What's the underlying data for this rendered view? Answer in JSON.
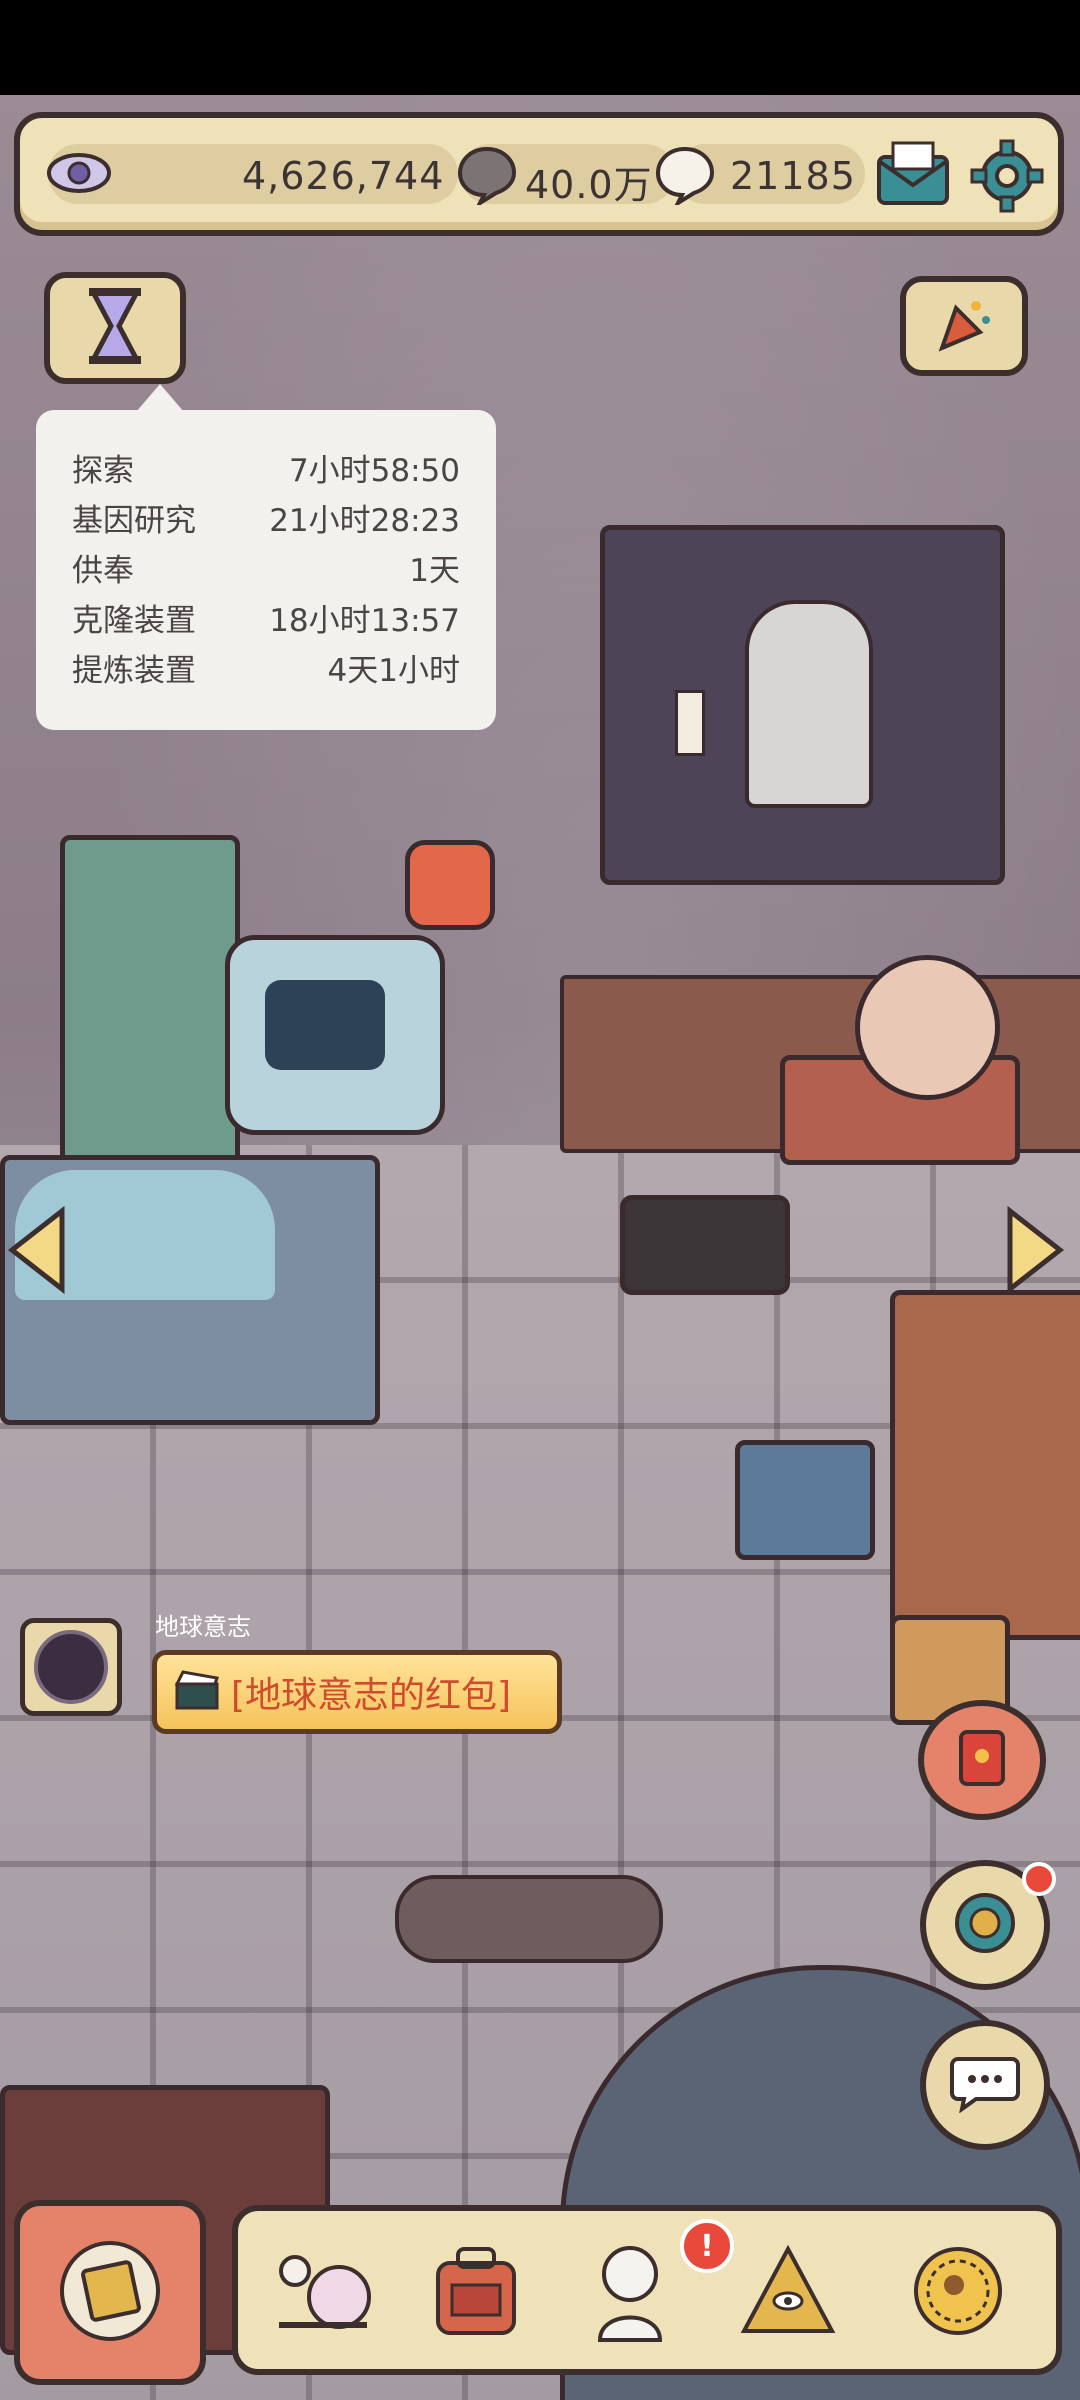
{
  "resources": {
    "eye_count": "4,626,744",
    "gray_bubble": "40.0万",
    "white_bubble": "21185"
  },
  "timers": [
    {
      "label": "探索",
      "value": "7小时58:50"
    },
    {
      "label": "基因研究",
      "value": "21小时28:23"
    },
    {
      "label": "供奉",
      "value": "1天"
    },
    {
      "label": "克隆装置",
      "value": "18小时13:57"
    },
    {
      "label": "提炼装置",
      "value": "4天1小时"
    }
  ],
  "chat_notice": {
    "sender": "地球意志",
    "message": "[地球意志的红包]"
  },
  "colors": {
    "bar_bg": "#efe1b8",
    "outline": "#3b2e2d",
    "accent_teal": "#3a8f95",
    "notice_text": "#d04a2c"
  },
  "icons": {
    "eye": "eye-icon",
    "bubble_gray": "speech-bubble-icon",
    "bubble_white": "speech-bubble-white-icon",
    "mail": "mail-icon",
    "settings": "gear-icon",
    "hourglass": "hourglass-icon",
    "party": "party-popper-icon"
  }
}
